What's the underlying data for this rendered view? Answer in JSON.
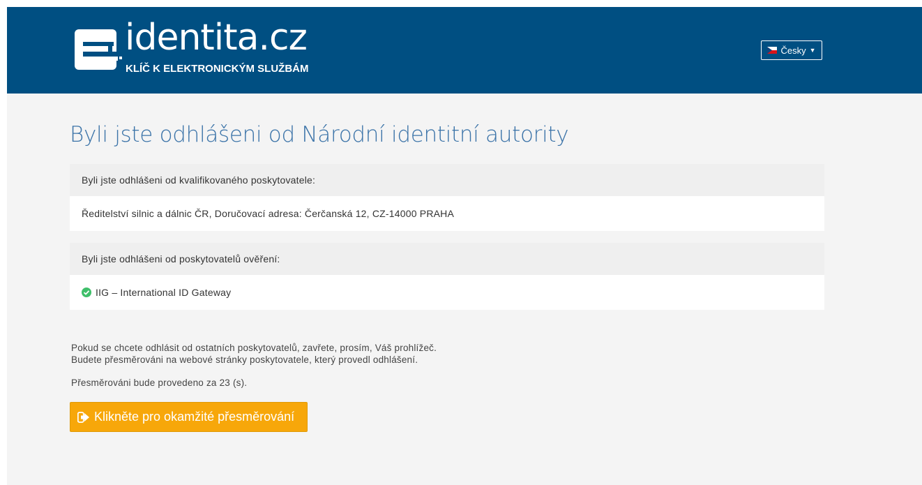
{
  "header": {
    "logo_text": "identita.cz",
    "logo_tagline": "KLÍČ K ELEKTRONICKÝM SLUŽBÁM",
    "language_label": "Česky",
    "colors": {
      "background": "#004f82",
      "text": "#ffffff"
    }
  },
  "main": {
    "title": "Byli jste odhlášeni od Národní identitní autority",
    "provider_panel": {
      "heading": "Byli jste odhlášeni od kvalifikovaného poskytovatele:",
      "value": "Ředitelství silnic a dálnic ČR, Doručovací adresa: Čerčanská 12, CZ-14000 PRAHA"
    },
    "verification_panel": {
      "heading": "Byli jste odhlášeni od poskytovatelů ověření:",
      "items": [
        {
          "label": "IIG – International ID Gateway",
          "icon": "check-circle-icon"
        }
      ]
    },
    "info_line_1": "Pokud se chcete odhlásit od ostatních poskytovatelů, zavřete, prosím, Váš prohlížeč.",
    "info_line_2": "Budete přesměrováni na webové stránky poskytovatele, který provedl odhlášení.",
    "countdown_text": "Přesměrováni bude provedeno za 23 (s).",
    "redirect_button_label": "Klikněte pro okamžité přesměrování",
    "colors": {
      "title": "#3b73a8",
      "button": "#f7a70a",
      "check": "#3fbf6a"
    }
  }
}
